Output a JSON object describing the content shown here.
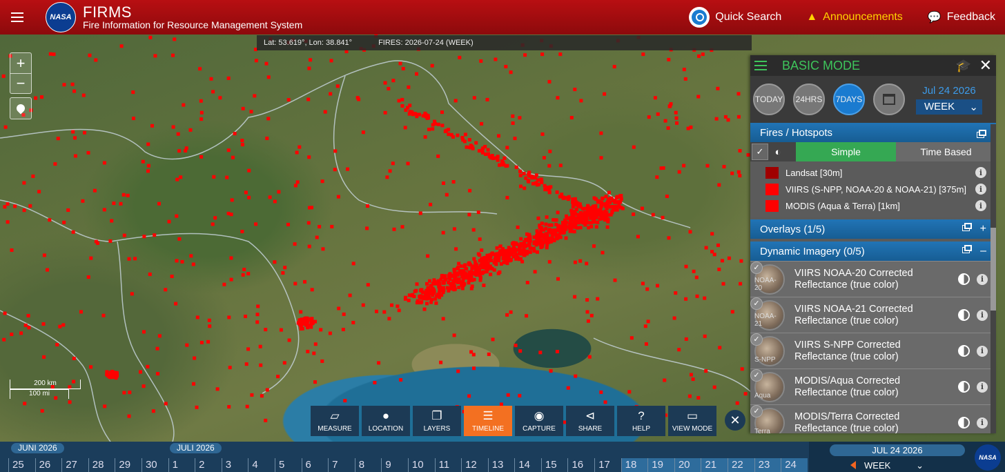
{
  "header": {
    "brand_title": "FIRMS",
    "brand_subtitle": "Fire Information for Resource Management System",
    "nasa_logo": "NASA",
    "quick_search": "Quick Search",
    "announcements": "Announcements",
    "feedback": "Feedback"
  },
  "map": {
    "coords": "Lat: 53.619°, Lon: 38.841°",
    "fires": "FIRES: 2026-07-24 (WEEK)",
    "zoom_in": "+",
    "zoom_out": "−",
    "scale_km": "200 km",
    "scale_mi": "100 mi"
  },
  "toolbar": {
    "items": [
      {
        "label": "MEASURE",
        "icon": "ruler-icon"
      },
      {
        "label": "LOCATION",
        "icon": "pin-icon"
      },
      {
        "label": "LAYERS",
        "icon": "layers-icon"
      },
      {
        "label": "TIMELINE",
        "icon": "sliders-icon",
        "active": true
      },
      {
        "label": "CAPTURE",
        "icon": "camera-icon"
      },
      {
        "label": "SHARE",
        "icon": "share-icon"
      },
      {
        "label": "HELP",
        "icon": "question-icon"
      },
      {
        "label": "VIEW MODE",
        "icon": "monitor-icon"
      }
    ]
  },
  "panel": {
    "mode_title": "BASIC MODE",
    "date_buttons": [
      "TODAY",
      "24HRS",
      "7DAYS"
    ],
    "selected_range": "7DAYS",
    "date": "Jul 24 2026",
    "period": "WEEK",
    "fires_section": "Fires / Hotspots",
    "mode_simple": "Simple",
    "mode_time": "Time Based",
    "legend": [
      {
        "label": "Landsat [30m]",
        "color": "#a00000"
      },
      {
        "label": "VIIRS (S-NPP, NOAA-20 & NOAA-21) [375m]",
        "color": "#ff0000"
      },
      {
        "label": "MODIS (Aqua & Terra) [1km]",
        "color": "#ff0000"
      }
    ],
    "overlays_section": "Overlays (1/5)",
    "dynamic_section": "Dynamic Imagery (0/5)",
    "layers": [
      {
        "name": "VIIRS NOAA-20 Corrected Reflectance (true color)",
        "sat": "NOAA-20"
      },
      {
        "name": "VIIRS NOAA-21 Corrected Reflectance (true color)",
        "sat": "NOAA-21"
      },
      {
        "name": "VIIRS S-NPP Corrected Reflectance (true color)",
        "sat": "S-NPP"
      },
      {
        "name": "MODIS/Aqua Corrected Reflectance (true color)",
        "sat": "Aqua"
      },
      {
        "name": "MODIS/Terra Corrected Reflectance (true color)",
        "sat": "Terra"
      }
    ]
  },
  "timeline": {
    "month1": "JUNI 2026",
    "month2": "JULI 2026",
    "days": [
      "25",
      "26",
      "27",
      "28",
      "29",
      "30",
      "1",
      "2",
      "3",
      "4",
      "5",
      "6",
      "7",
      "8",
      "9",
      "10",
      "11",
      "12",
      "13",
      "14",
      "15",
      "16",
      "17",
      "18",
      "19",
      "20",
      "21",
      "22",
      "23",
      "24"
    ],
    "selected_from": 23,
    "date": "JUL 24 2026",
    "period": "WEEK"
  },
  "colors": {
    "header_red": "#b80f12",
    "fire_red": "#ff0000",
    "accent_green": "#3ec45b",
    "active_orange": "#f37021",
    "panel_blue": "#2174b6"
  }
}
